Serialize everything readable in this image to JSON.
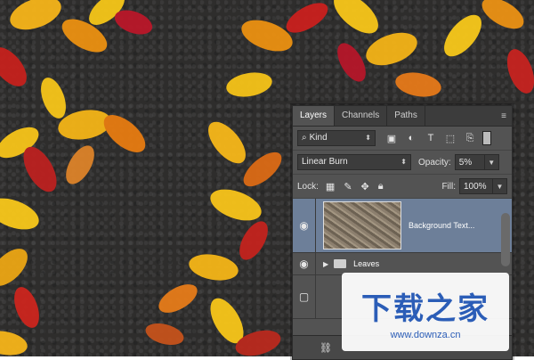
{
  "panel": {
    "tabs": [
      {
        "label": "Layers",
        "active": true
      },
      {
        "label": "Channels",
        "active": false
      },
      {
        "label": "Paths",
        "active": false
      }
    ],
    "filter": {
      "value": "Kind",
      "icon": "search-icon"
    },
    "blend_mode": {
      "value": "Linear Burn"
    },
    "opacity": {
      "label": "Opacity:",
      "value": "5%"
    },
    "lock": {
      "label": "Lock:"
    },
    "fill": {
      "label": "Fill:",
      "value": "100%"
    },
    "layers": [
      {
        "name": "Background Text...",
        "visible": true,
        "selected": true,
        "type": "image"
      },
      {
        "name": "Leaves",
        "visible": true,
        "selected": false,
        "type": "group"
      }
    ]
  },
  "watermark": {
    "text_cn": "下载之家",
    "url": "www.downza.cn"
  },
  "colors": {
    "panel_bg": "#535353",
    "selected_layer": "#6d7f99",
    "watermark_blue": "#2b5db7"
  }
}
